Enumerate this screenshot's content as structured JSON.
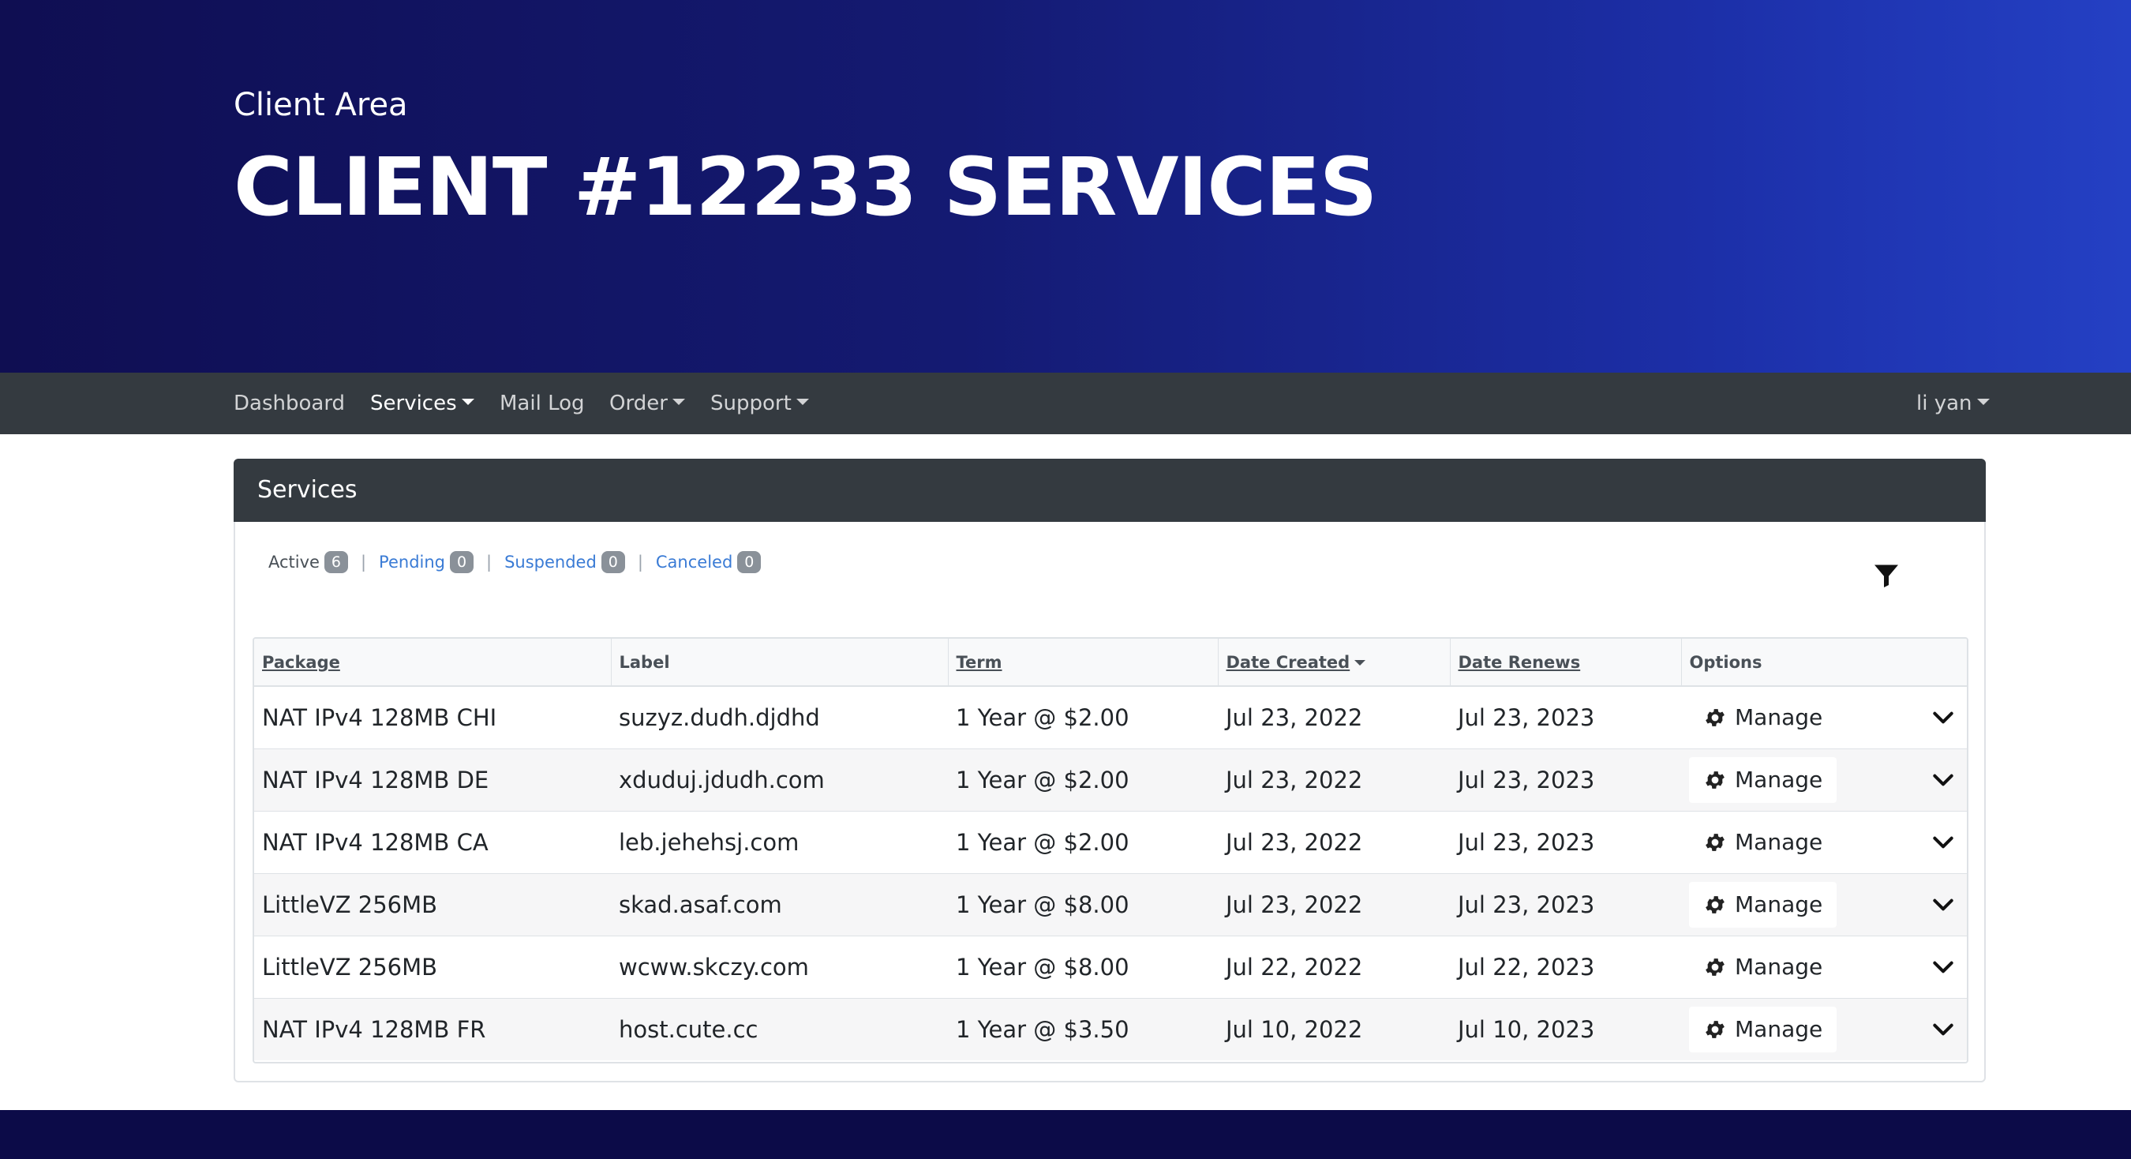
{
  "hero": {
    "subtitle": "Client Area",
    "title": "CLIENT #12233 SERVICES"
  },
  "navbar": {
    "items": [
      {
        "label": "Dashboard",
        "dropdown": false,
        "active": false
      },
      {
        "label": "Services",
        "dropdown": true,
        "active": true
      },
      {
        "label": "Mail Log",
        "dropdown": false,
        "active": false
      },
      {
        "label": "Order",
        "dropdown": true,
        "active": false
      },
      {
        "label": "Support",
        "dropdown": true,
        "active": false
      }
    ],
    "user": "li yan"
  },
  "card": {
    "title": "Services"
  },
  "filters": [
    {
      "label": "Active",
      "count": "6"
    },
    {
      "label": "Pending",
      "count": "0"
    },
    {
      "label": "Suspended",
      "count": "0"
    },
    {
      "label": "Canceled",
      "count": "0"
    }
  ],
  "table": {
    "headers": [
      "Package",
      "Label",
      "Term",
      "Date Created",
      "Date Renews",
      "Options"
    ],
    "manage_label": "Manage",
    "rows": [
      {
        "package": "NAT IPv4 128MB CHI",
        "label": "suzyz.dudh.djdhd",
        "term": "1 Year @ $2.00",
        "created": "Jul 23, 2022",
        "renews": "Jul 23, 2023"
      },
      {
        "package": "NAT IPv4 128MB DE",
        "label": "xduduj.jdudh.com",
        "term": "1 Year @ $2.00",
        "created": "Jul 23, 2022",
        "renews": "Jul 23, 2023"
      },
      {
        "package": "NAT IPv4 128MB CA",
        "label": "leb.jehehsj.com",
        "term": "1 Year @ $2.00",
        "created": "Jul 23, 2022",
        "renews": "Jul 23, 2023"
      },
      {
        "package": "LittleVZ 256MB",
        "label": "skad.asaf.com",
        "term": "1 Year @ $8.00",
        "created": "Jul 23, 2022",
        "renews": "Jul 23, 2023"
      },
      {
        "package": "LittleVZ 256MB",
        "label": "wcww.skczy.com",
        "term": "1 Year @ $8.00",
        "created": "Jul 22, 2022",
        "renews": "Jul 22, 2023"
      },
      {
        "package": "NAT IPv4 128MB FR",
        "label": "host.cute.cc",
        "term": "1 Year @ $3.50",
        "created": "Jul 10, 2022",
        "renews": "Jul 10, 2023"
      }
    ]
  },
  "colors": {
    "hero_dark": "#0f0e52",
    "hero_light": "#2440c4",
    "navbar": "#343a40",
    "link": "#3a7bd5",
    "badge": "#8a9199"
  }
}
